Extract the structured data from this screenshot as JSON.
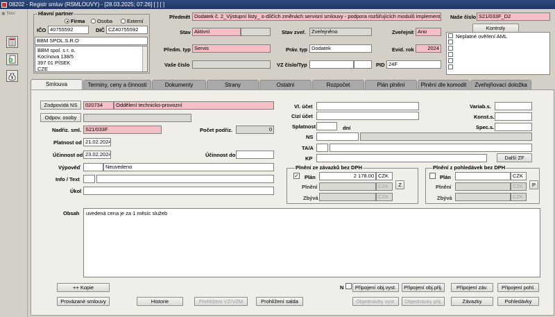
{
  "window": {
    "title": "08202 - Registr smluv (RSMLOUVY) - [28.03.2025; 07:26]  [ ]  [ ]"
  },
  "nav": {
    "label": "Nav",
    "icons": [
      "document-icon",
      "plus-document-icon",
      "money-bag-icon"
    ]
  },
  "partner": {
    "group_label": "Hlavní partner",
    "radios": [
      {
        "label": "Firma",
        "selected": true
      },
      {
        "label": "Osoba",
        "selected": false
      },
      {
        "label": "Externí",
        "selected": false
      }
    ],
    "ico_label": "IČO",
    "ico": "40755592",
    "dic_label": "DIČ",
    "dic": "CZ40755592",
    "name": "BBM SPOL.S.R.O",
    "address_lines": [
      "BBM spol. s r. o.",
      "Kocínova 138/5",
      "397 01 PÍSEK",
      "CZE"
    ]
  },
  "header": {
    "predmet_label": "Předmět",
    "predmet": "Dodatek č. 2_Výstupní listy_ o dílčích změnách servisní smlouvy - podpora rozšiřujících modulů implementace",
    "nase_cislo_label": "Naše číslo",
    "nase_cislo": "S21/033F_D2",
    "stav_label": "Stav",
    "stav": "Aktivní",
    "stav_zver_label": "Stav zveř.",
    "stav_zver": "Zveřejněno",
    "zverejnit_label": "Zveřejnit",
    "zverejnit": "Ano",
    "predm_typ_label": "Předm. typ",
    "predm_typ": "Servis",
    "prav_typ_label": "Práv. typ",
    "prav_typ": "Dodatek",
    "evid_rok_label": "Evid. rok",
    "evid_rok": "2024",
    "vase_cislo_label": "Vaše číslo",
    "vase_cislo": "",
    "vz_cislo_label": "VZ číslo/Typ",
    "pid_label": "PID",
    "pid": "24F",
    "kontroly_button": "Kontroly",
    "kontroly_items": [
      "Neplatné ověření AML",
      "",
      "",
      "",
      "",
      ""
    ]
  },
  "tabs": [
    {
      "label": "Smlouva",
      "active": true
    },
    {
      "label": "Terminy, ceny a činnosti",
      "active": false
    },
    {
      "label": "Dokumenty",
      "active": false
    },
    {
      "label": "Strany",
      "active": false
    },
    {
      "label": "Ostatní",
      "active": false
    },
    {
      "label": "Rozpočet",
      "active": false
    },
    {
      "label": "Plán plnění",
      "active": false
    },
    {
      "label": "Plnění dle komodit",
      "active": false
    },
    {
      "label": "Zveřejňovací doložka",
      "active": false
    }
  ],
  "smlouva": {
    "zodpovida_ns_button": "Zodpovídá NS",
    "zodpovida_ns_code": "020734",
    "zodpovida_ns_name": "Oddělení technicko-provozní",
    "odpov_osoby_button": "Odpov. osoby",
    "nadriz_sml_label": "Nadřiz. sml.",
    "nadriz_sml": "S21/033F",
    "pocet_podriz_label": "Počet podřiz.",
    "pocet_podriz": "0",
    "platnost_od_label": "Platnost od",
    "platnost_od": "21.02.2024",
    "ucinnost_od_label": "Účinnost od",
    "ucinnost_od": "23.02.2024",
    "ucinnost_do_label": "Účinnost do",
    "ucinnost_do": "",
    "vypoved_label": "Výpověď",
    "vypoved": "Neuvedeno",
    "info_text_label": "Info / Text",
    "ukol_label": "Úkol",
    "vl_ucet_label": "Vl. účet",
    "cizi_ucet_label": "Cizí účet",
    "splatnost_label": "Splatnost",
    "dni_label": "dní",
    "variab_label": "Variab.s.",
    "konst_label": "Konst.s.",
    "spec_label": "Spec.s.",
    "ns_label": "NS",
    "ta_label": "TA/A",
    "kp_label": "KP",
    "dalsi_zf_button": "Další ZF",
    "obsah_label": "Obsah",
    "obsah": "uvedená cena je za 1 měsíc služeb"
  },
  "plneni_zavazku": {
    "title": "Plnění ze závazků bez DPH",
    "plan_label": "Plán",
    "plan_checked": true,
    "plan_value": "2 178.00",
    "currency": "CZK",
    "plneni_label": "Plnění",
    "zbyva_label": "Zbývá",
    "side_button": "Z"
  },
  "plneni_pohledavek": {
    "title": "Plnění z pohledávek bez DPH",
    "plan_label": "Plán",
    "plan_checked": false,
    "plan_value": "",
    "currency": "CZK",
    "plneni_label": "Plnění",
    "zbyva_label": "Zbývá",
    "side_button": "P"
  },
  "footer": {
    "kopie_button": "++ Kopie",
    "provazane_button": "Provázané smlouvy",
    "historie_button": "Historie",
    "prohlizeni_vz_button": "Prohlížení VZ/VZM",
    "prohlizeni_salda_button": "Prohlížení salda",
    "n_label": "N",
    "pripojeni_obj_vyst": "Připojení obj.vyst.",
    "pripojeni_obj_prij": "Připojení obj.přij.",
    "pripojeni_zav": "Připojení záv.",
    "pripojeni_pohl": "Připojení pohl.",
    "objednavky_vyst": "Objednávky vyst.",
    "objednavky_prij": "Objednávky přij.",
    "zavazky": "Závazky",
    "pohledavky": "Pohledávky"
  }
}
